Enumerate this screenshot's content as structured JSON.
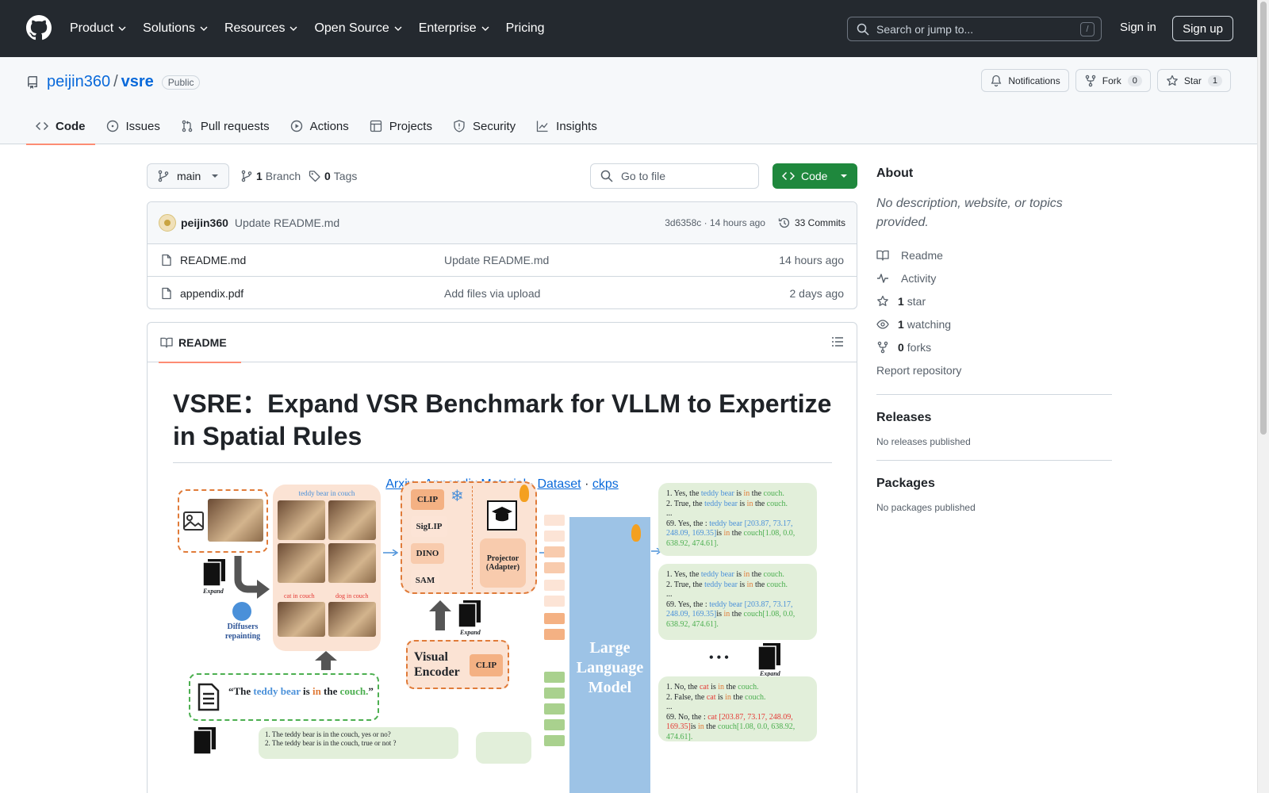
{
  "header": {
    "nav": [
      "Product",
      "Solutions",
      "Resources",
      "Open Source",
      "Enterprise",
      "Pricing"
    ],
    "search_placeholder": "Search or jump to...",
    "search_key": "/",
    "signin": "Sign in",
    "signup": "Sign up"
  },
  "repo": {
    "owner": "peijin360",
    "separator": "/",
    "name": "vsre",
    "visibility": "Public",
    "notifications_label": "Notifications",
    "fork_label": "Fork",
    "fork_count": "0",
    "star_label": "Star",
    "star_count": "1",
    "tabs": [
      {
        "label": "Code",
        "icon": "code-icon"
      },
      {
        "label": "Issues",
        "icon": "issue-icon"
      },
      {
        "label": "Pull requests",
        "icon": "pull-request-icon"
      },
      {
        "label": "Actions",
        "icon": "play-icon"
      },
      {
        "label": "Projects",
        "icon": "table-icon"
      },
      {
        "label": "Security",
        "icon": "shield-icon"
      },
      {
        "label": "Insights",
        "icon": "graph-icon"
      }
    ]
  },
  "toolbar": {
    "branch": "main",
    "branch_count": "1",
    "branch_label": "Branch",
    "tag_count": "0",
    "tag_label": "Tags",
    "go_to_file": "Go to file",
    "code_button": "Code"
  },
  "commit": {
    "author": "peijin360",
    "message": "Update README.md",
    "meta": "3d6358c · 14 hours ago",
    "count": "33 Commits"
  },
  "files": [
    {
      "name": "README.md",
      "message": "Update README.md",
      "time": "14 hours ago"
    },
    {
      "name": "appendix.pdf",
      "message": "Add files via upload",
      "time": "2 days ago"
    }
  ],
  "readme": {
    "tab": "README",
    "title": "VSRE：Expand VSR Benchmark for VLLM to Expertize in Spatial Rules",
    "links": [
      "Arxiv",
      "Appendix Material",
      "Dataset",
      "ckps"
    ],
    "link_sep": "·"
  },
  "figure": {
    "img_caption": "teddy bear in couch",
    "cat_caption": "cat in couch",
    "dog_caption": "dog in couch",
    "expand": "Expand",
    "diffusers": "Diffusers repainting",
    "encoders": [
      "CLIP",
      "SigLIP",
      "DINO",
      "SAM"
    ],
    "projector": "Projector (Adapter)",
    "visual_encoder": "Visual Encoder",
    "visual_encoder_chip": "CLIP",
    "llm": "Large Language Model",
    "ellipsis": "• • •",
    "quote_prefix": "“The ",
    "quote_obj": "teddy bear",
    "quote_rel": " is ",
    "quote_in": "in",
    "quote_the": " the ",
    "quote_subj": "couch.",
    "quote_end": "”",
    "resp1": {
      "l1a": "1. Yes, the ",
      "l1b": "teddy bear",
      "l1c": " is ",
      "l1d": "in",
      "l1e": " the ",
      "l1f": "couch.",
      "l2a": "2. True, the ",
      "l2b": "teddy bear",
      "l2c": " is ",
      "l2d": "in",
      "l2e": " the ",
      "l2f": "couch.",
      "dots": "...",
      "l3a": "69. Yes, the : ",
      "l3b": "teddy bear [203.87, 73.17, 248.09, 169.35]",
      "l3c": "is ",
      "l3d": "in",
      "l3e": " the ",
      "l3f": "couch[1.08, 0.0, 638.92, 474.61]."
    },
    "resp3": {
      "l1a": "1. No, the ",
      "l1b": "cat",
      "l1c": " is ",
      "l1d": "in",
      "l1e": " the ",
      "l1f": "couch.",
      "l2a": "2. False, the ",
      "l2b": "cat",
      "l2c": " is ",
      "l2d": "in",
      "l2e": " the ",
      "l2f": "couch.",
      "dots": "...",
      "l3a": "69. No, the : ",
      "l3b": "cat [203.87, 73.17, 248.09, 169.35]",
      "l3c": "is ",
      "l3d": "in",
      "l3e": " the ",
      "l3f": "couch[1.08, 0.0, 638.92, 474.61]."
    },
    "bottom_l1": "1. The teddy bear is in the couch,    yes or no?",
    "bottom_l2": "2. The teddy bear is in the couch,    true or not ?"
  },
  "sidebar": {
    "about": "About",
    "description": "No description, website, or topics provided.",
    "items": [
      {
        "icon": "book-icon",
        "bold": "",
        "text": "Readme"
      },
      {
        "icon": "pulse-icon",
        "bold": "",
        "text": "Activity"
      },
      {
        "icon": "star-icon",
        "bold": "1",
        "text": "star"
      },
      {
        "icon": "eye-icon",
        "bold": "1",
        "text": "watching"
      },
      {
        "icon": "fork-icon",
        "bold": "0",
        "text": "forks"
      }
    ],
    "report": "Report repository",
    "releases": "Releases",
    "no_releases": "No releases published",
    "packages": "Packages",
    "no_packages": "No packages published"
  },
  "colors": {
    "header_bg": "#24292f",
    "accent": "#0969da",
    "code_green": "#1f883d",
    "tab_underline": "#fd8c73"
  }
}
